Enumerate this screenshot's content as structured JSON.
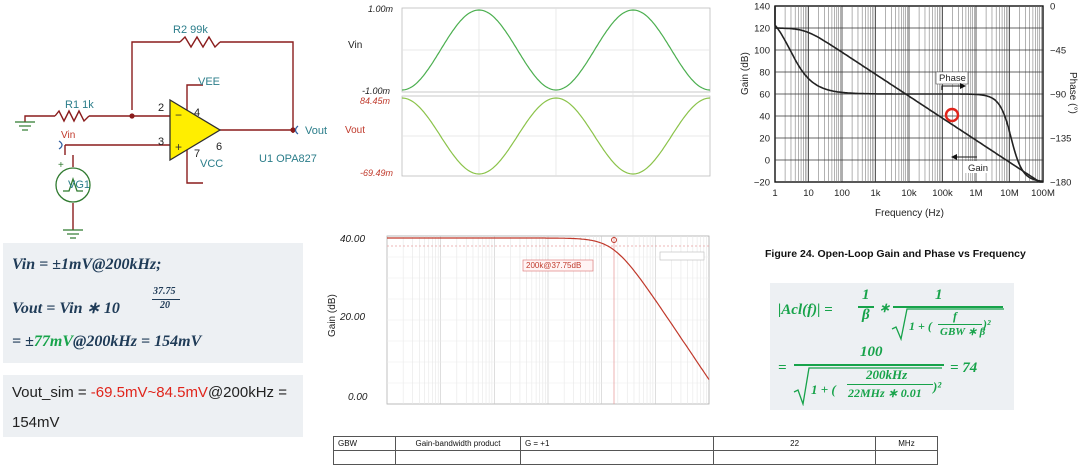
{
  "schematic": {
    "r2_label": "R2 99k",
    "r1_label": "R1 1k",
    "vee": "VEE",
    "vcc": "VCC",
    "pin2": "2",
    "pin3": "3",
    "pin4": "4",
    "pin6": "6",
    "pin7": "7",
    "vin": "Vin",
    "vout": "Vout",
    "opamp": "U1 OPA827",
    "source": "VG1",
    "plus": "+",
    "minus": "−"
  },
  "equations": {
    "line1": "Vin = ±1mV@200kHz;",
    "line2_lead": "Vout = Vin ∗ 10",
    "line2_exp_num": "37.75",
    "line2_exp_den": "20",
    "line3_lead": "= ±",
    "line3_green": "77mV",
    "line3_tail": "@200kHz = 154mV"
  },
  "sim_result": {
    "prefix": "Vout_sim = ",
    "value": "-69.5mV~84.5mV",
    "suffix": "@200kHz =",
    "line2": "154mV"
  },
  "transient": {
    "vin_label": "Vin",
    "vout_label": "Vout",
    "vin_top": "1.00m",
    "vin_bottom": "-1.00m",
    "vout_top": "84.45m",
    "vout_bottom": "-69.49m",
    "vin_color": "#4caf50",
    "vout_color": "#8bc34a"
  },
  "ac_plot": {
    "ylabel": "Gain (dB)",
    "y_top": "40.00",
    "y_mid": "20.00",
    "y_bottom": "0.00",
    "marker_label": "200k@37.75dB",
    "curve_color": "#c0392b"
  },
  "openloop_chart": {
    "ylabel": "Gain (dB)",
    "y2label": "Phase (°)",
    "xlabel": "Frequency (Hz)",
    "gain_ticks": [
      "140",
      "120",
      "100",
      "80",
      "60",
      "40",
      "20",
      "0",
      "−20"
    ],
    "phase_ticks": [
      "0",
      "−45",
      "−90",
      "−135",
      "−180"
    ],
    "freq_ticks": [
      "1",
      "10",
      "100",
      "1k",
      "10k",
      "100k",
      "1M",
      "10M",
      "100M"
    ],
    "phase_annot": "Phase",
    "gain_annot": "Gain",
    "caption": "Figure 24. Open-Loop Gain and Phase vs Frequency",
    "marker_color": "#e0241b"
  },
  "acl_formula": {
    "lhs": "|Acl(f)| =",
    "one": "1",
    "beta": "β",
    "times": "∗",
    "under": "1 + (",
    "f": "f",
    "gbwb": "GBW ∗ β",
    "sq": ")²",
    "eq2": "=",
    "hundred": "100",
    "under2": "1 + (",
    "n200": "200kHz",
    "d22": "22MHz ∗ 0.01",
    "res": "= 74"
  },
  "gbw_table": {
    "c1": "GBW",
    "c2": "Gain-bandwidth product",
    "c3": "G = +1",
    "c4": "22",
    "c5": "MHz"
  }
}
